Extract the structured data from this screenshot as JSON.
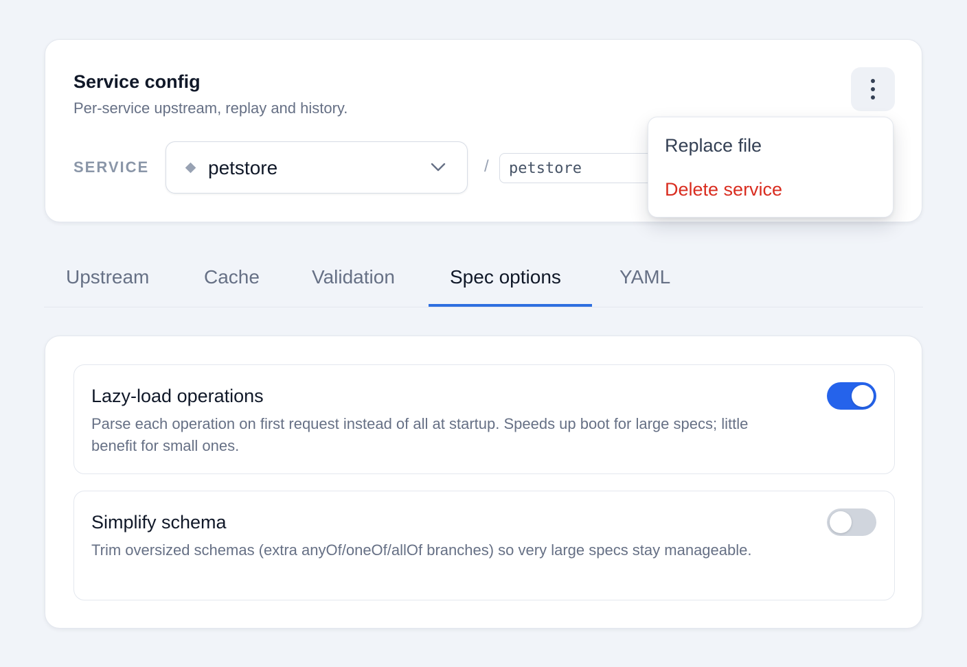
{
  "config": {
    "title": "Service config",
    "subtitle": "Per-service upstream, replay and history.",
    "service_label": "SERVICE",
    "service_selected": "petstore",
    "path_separator": "/",
    "path_value": "petstore",
    "more_icon": "more-vertical-icon"
  },
  "menu": {
    "items": [
      {
        "label": "Replace file"
      },
      {
        "label": "Delete service",
        "color": "#d92d20"
      }
    ]
  },
  "tabs": [
    {
      "label": "Upstream",
      "active": false
    },
    {
      "label": "Cache",
      "active": false
    },
    {
      "label": "Validation",
      "active": false
    },
    {
      "label": "Spec options",
      "active": true
    },
    {
      "label": "YAML",
      "active": false
    }
  ],
  "spec_options": [
    {
      "title": "Lazy-load operations",
      "description": "Parse each operation on first request instead of all at startup. Speeds up boot for large specs; little benefit for small ones.",
      "enabled": true
    },
    {
      "title": "Simplify schema",
      "description": "Trim oversized schemas (extra anyOf/oneOf/allOf branches) so very large specs stay manageable.",
      "enabled": false
    }
  ],
  "colors": {
    "accent": "#2563eb",
    "danger": "#d92d20"
  }
}
